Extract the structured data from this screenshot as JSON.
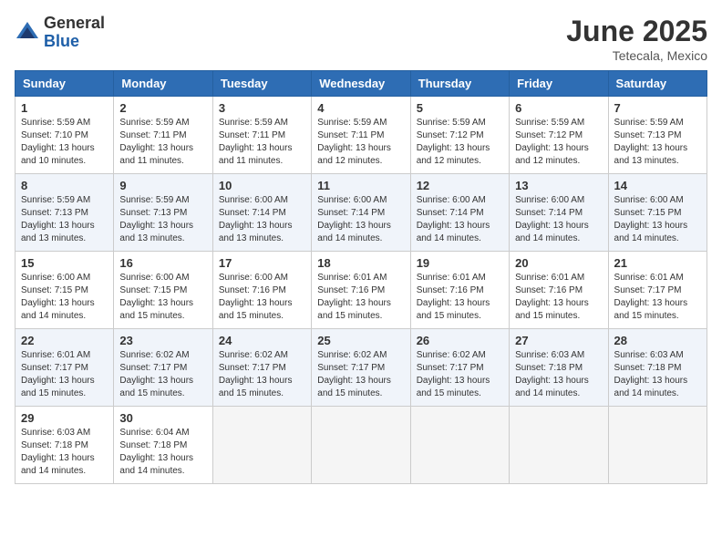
{
  "logo": {
    "general": "General",
    "blue": "Blue"
  },
  "title": "June 2025",
  "location": "Tetecala, Mexico",
  "weekdays": [
    "Sunday",
    "Monday",
    "Tuesday",
    "Wednesday",
    "Thursday",
    "Friday",
    "Saturday"
  ],
  "weeks": [
    [
      {
        "day": 1,
        "lines": [
          "Sunrise: 5:59 AM",
          "Sunset: 7:10 PM",
          "Daylight: 13 hours",
          "and 10 minutes."
        ]
      },
      {
        "day": 2,
        "lines": [
          "Sunrise: 5:59 AM",
          "Sunset: 7:11 PM",
          "Daylight: 13 hours",
          "and 11 minutes."
        ]
      },
      {
        "day": 3,
        "lines": [
          "Sunrise: 5:59 AM",
          "Sunset: 7:11 PM",
          "Daylight: 13 hours",
          "and 11 minutes."
        ]
      },
      {
        "day": 4,
        "lines": [
          "Sunrise: 5:59 AM",
          "Sunset: 7:11 PM",
          "Daylight: 13 hours",
          "and 12 minutes."
        ]
      },
      {
        "day": 5,
        "lines": [
          "Sunrise: 5:59 AM",
          "Sunset: 7:12 PM",
          "Daylight: 13 hours",
          "and 12 minutes."
        ]
      },
      {
        "day": 6,
        "lines": [
          "Sunrise: 5:59 AM",
          "Sunset: 7:12 PM",
          "Daylight: 13 hours",
          "and 12 minutes."
        ]
      },
      {
        "day": 7,
        "lines": [
          "Sunrise: 5:59 AM",
          "Sunset: 7:13 PM",
          "Daylight: 13 hours",
          "and 13 minutes."
        ]
      }
    ],
    [
      {
        "day": 8,
        "lines": [
          "Sunrise: 5:59 AM",
          "Sunset: 7:13 PM",
          "Daylight: 13 hours",
          "and 13 minutes."
        ]
      },
      {
        "day": 9,
        "lines": [
          "Sunrise: 5:59 AM",
          "Sunset: 7:13 PM",
          "Daylight: 13 hours",
          "and 13 minutes."
        ]
      },
      {
        "day": 10,
        "lines": [
          "Sunrise: 6:00 AM",
          "Sunset: 7:14 PM",
          "Daylight: 13 hours",
          "and 13 minutes."
        ]
      },
      {
        "day": 11,
        "lines": [
          "Sunrise: 6:00 AM",
          "Sunset: 7:14 PM",
          "Daylight: 13 hours",
          "and 14 minutes."
        ]
      },
      {
        "day": 12,
        "lines": [
          "Sunrise: 6:00 AM",
          "Sunset: 7:14 PM",
          "Daylight: 13 hours",
          "and 14 minutes."
        ]
      },
      {
        "day": 13,
        "lines": [
          "Sunrise: 6:00 AM",
          "Sunset: 7:14 PM",
          "Daylight: 13 hours",
          "and 14 minutes."
        ]
      },
      {
        "day": 14,
        "lines": [
          "Sunrise: 6:00 AM",
          "Sunset: 7:15 PM",
          "Daylight: 13 hours",
          "and 14 minutes."
        ]
      }
    ],
    [
      {
        "day": 15,
        "lines": [
          "Sunrise: 6:00 AM",
          "Sunset: 7:15 PM",
          "Daylight: 13 hours",
          "and 14 minutes."
        ]
      },
      {
        "day": 16,
        "lines": [
          "Sunrise: 6:00 AM",
          "Sunset: 7:15 PM",
          "Daylight: 13 hours",
          "and 15 minutes."
        ]
      },
      {
        "day": 17,
        "lines": [
          "Sunrise: 6:00 AM",
          "Sunset: 7:16 PM",
          "Daylight: 13 hours",
          "and 15 minutes."
        ]
      },
      {
        "day": 18,
        "lines": [
          "Sunrise: 6:01 AM",
          "Sunset: 7:16 PM",
          "Daylight: 13 hours",
          "and 15 minutes."
        ]
      },
      {
        "day": 19,
        "lines": [
          "Sunrise: 6:01 AM",
          "Sunset: 7:16 PM",
          "Daylight: 13 hours",
          "and 15 minutes."
        ]
      },
      {
        "day": 20,
        "lines": [
          "Sunrise: 6:01 AM",
          "Sunset: 7:16 PM",
          "Daylight: 13 hours",
          "and 15 minutes."
        ]
      },
      {
        "day": 21,
        "lines": [
          "Sunrise: 6:01 AM",
          "Sunset: 7:17 PM",
          "Daylight: 13 hours",
          "and 15 minutes."
        ]
      }
    ],
    [
      {
        "day": 22,
        "lines": [
          "Sunrise: 6:01 AM",
          "Sunset: 7:17 PM",
          "Daylight: 13 hours",
          "and 15 minutes."
        ]
      },
      {
        "day": 23,
        "lines": [
          "Sunrise: 6:02 AM",
          "Sunset: 7:17 PM",
          "Daylight: 13 hours",
          "and 15 minutes."
        ]
      },
      {
        "day": 24,
        "lines": [
          "Sunrise: 6:02 AM",
          "Sunset: 7:17 PM",
          "Daylight: 13 hours",
          "and 15 minutes."
        ]
      },
      {
        "day": 25,
        "lines": [
          "Sunrise: 6:02 AM",
          "Sunset: 7:17 PM",
          "Daylight: 13 hours",
          "and 15 minutes."
        ]
      },
      {
        "day": 26,
        "lines": [
          "Sunrise: 6:02 AM",
          "Sunset: 7:17 PM",
          "Daylight: 13 hours",
          "and 15 minutes."
        ]
      },
      {
        "day": 27,
        "lines": [
          "Sunrise: 6:03 AM",
          "Sunset: 7:18 PM",
          "Daylight: 13 hours",
          "and 14 minutes."
        ]
      },
      {
        "day": 28,
        "lines": [
          "Sunrise: 6:03 AM",
          "Sunset: 7:18 PM",
          "Daylight: 13 hours",
          "and 14 minutes."
        ]
      }
    ],
    [
      {
        "day": 29,
        "lines": [
          "Sunrise: 6:03 AM",
          "Sunset: 7:18 PM",
          "Daylight: 13 hours",
          "and 14 minutes."
        ]
      },
      {
        "day": 30,
        "lines": [
          "Sunrise: 6:04 AM",
          "Sunset: 7:18 PM",
          "Daylight: 13 hours",
          "and 14 minutes."
        ]
      },
      null,
      null,
      null,
      null,
      null
    ]
  ]
}
